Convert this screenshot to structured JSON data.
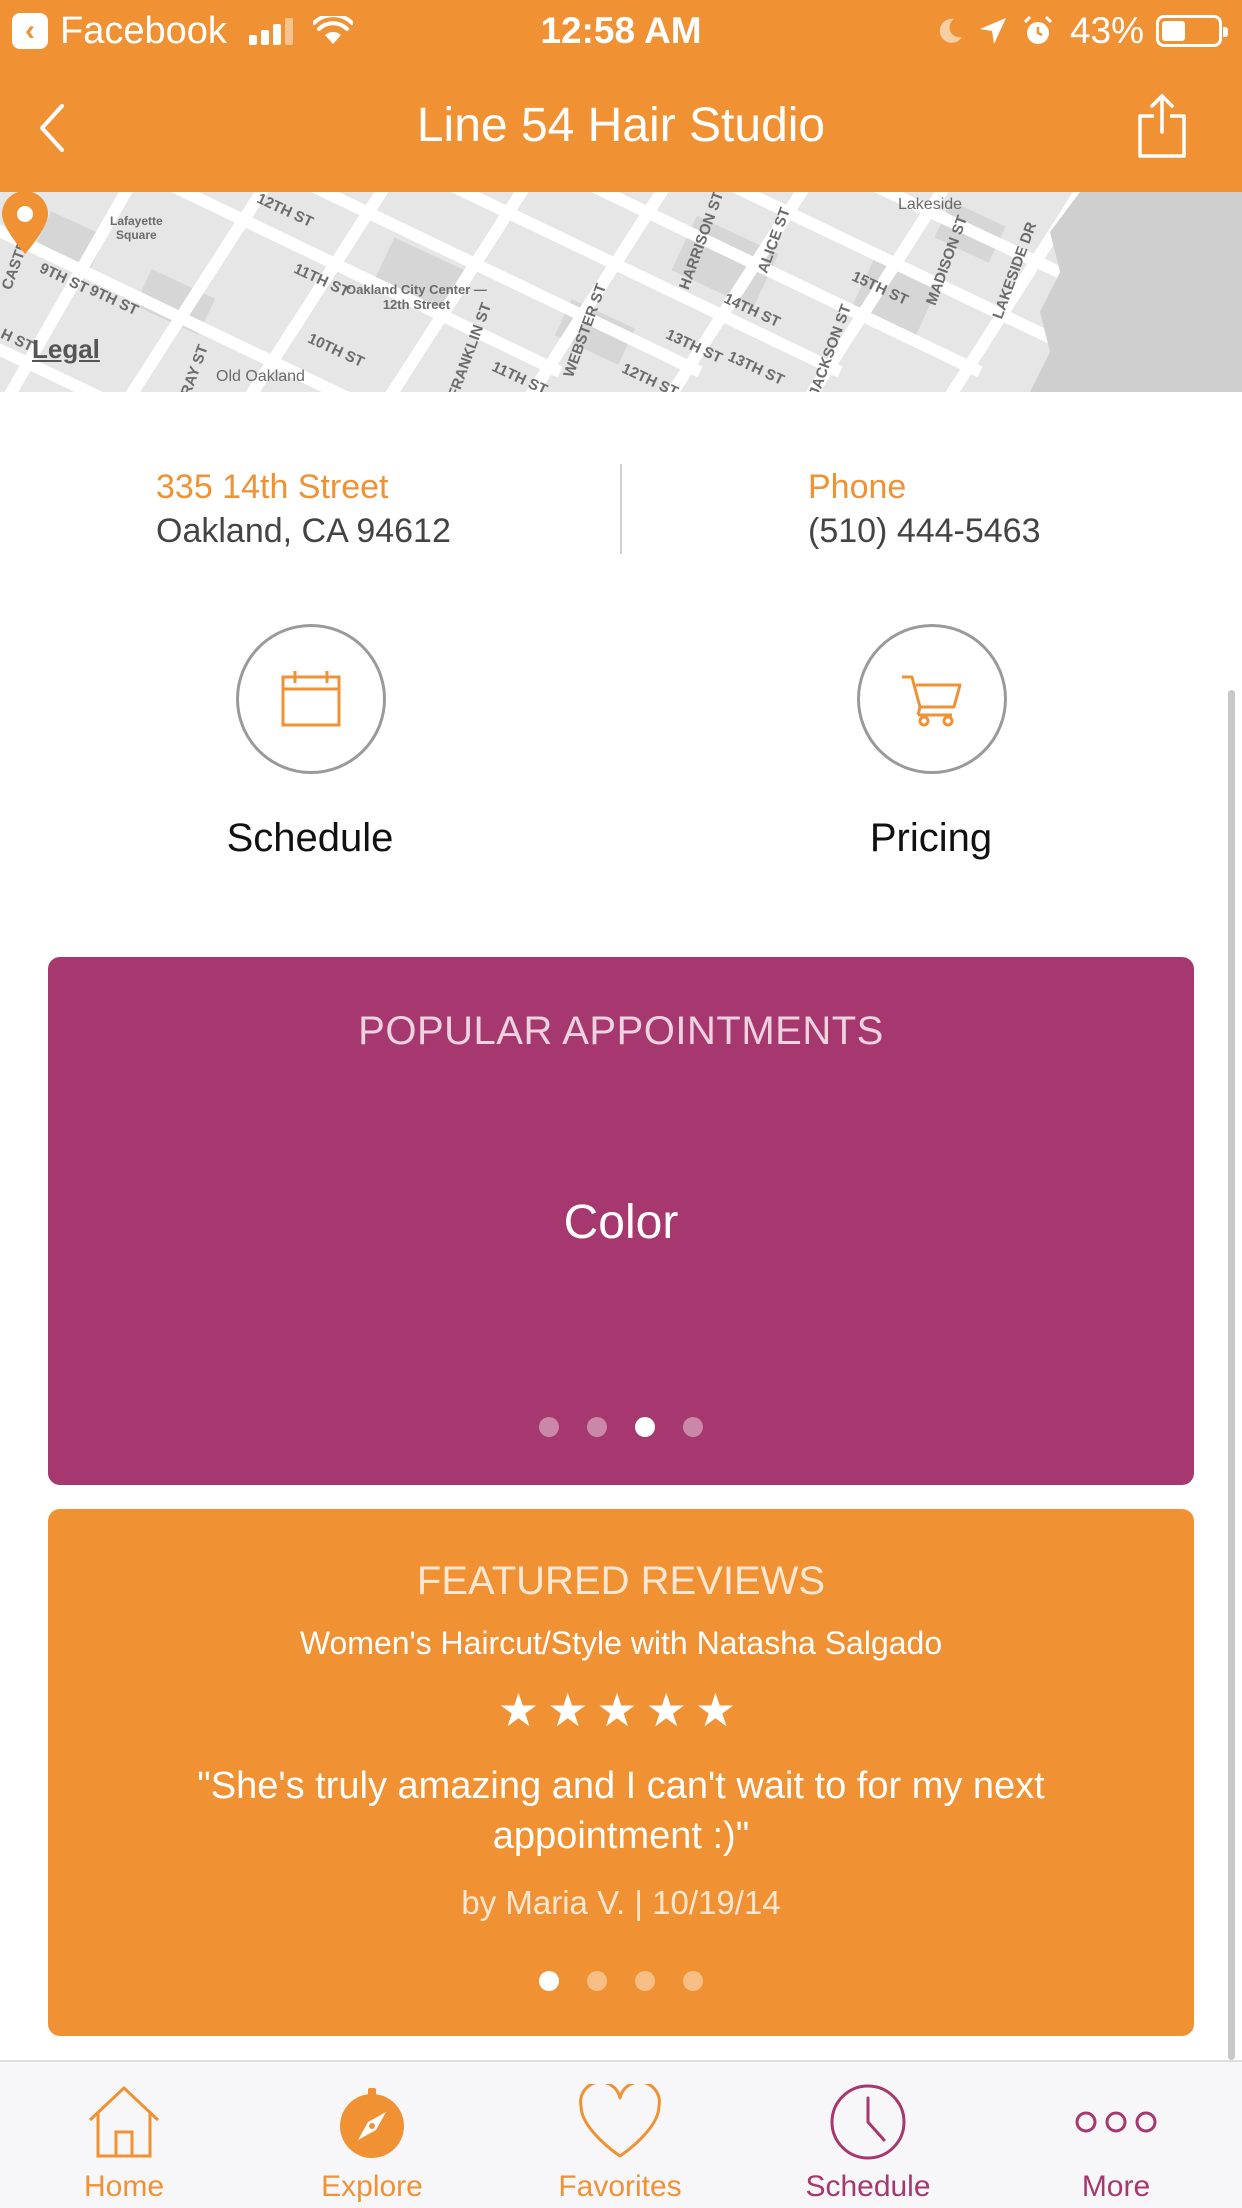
{
  "status_bar": {
    "back_app": "Facebook",
    "time": "12:58 AM",
    "battery": "43%",
    "battery_level": 0.43
  },
  "nav": {
    "title": "Line 54 Hair Studio"
  },
  "map": {
    "legal": "Legal",
    "labels": {
      "lafayette": "Lafayette\nSquare",
      "st_12th": "12TH ST",
      "castro": "CASTRO ST",
      "st_9th_a": "9TH ST",
      "st_9th_b": "9TH ST",
      "st_11th": "11TH ST",
      "city_center": "Oakland City Center —\n12th Street",
      "st_10th": "10TH ST",
      "old_oakland": "Old Oakland",
      "franklin": "FRANKLIN ST",
      "webster": "WEBSTER ST",
      "st_11th_b": "11TH ST",
      "harrison": "HARRISON ST",
      "alice": "ALICE ST",
      "st_14th": "14TH ST",
      "st_13th": "13TH ST",
      "st_13th_b": "13TH ST",
      "jackson": "JACKSON ST",
      "st_12th_b": "12TH ST",
      "lakeside": "Lakeside",
      "madison": "MADISON ST",
      "st_15th": "15TH ST",
      "lakeside_dr": "LAKESIDE DR",
      "ray": "RAY ST",
      "hst": "H ST"
    }
  },
  "contact": {
    "address_line1": "335 14th Street",
    "address_line2": "Oakland, CA 94612",
    "phone_label": "Phone",
    "phone_number": "(510) 444-5463"
  },
  "actions": {
    "schedule_label": "Schedule",
    "pricing_label": "Pricing"
  },
  "popular": {
    "title": "POPULAR APPOINTMENTS",
    "current_item": "Color",
    "page_count": 4,
    "active_page": 3
  },
  "reviews": {
    "title": "FEATURED REVIEWS",
    "service": "Women's Haircut/Style with Natasha Salgado",
    "stars": "★★★★★",
    "rating": 5,
    "quote": "\"She's truly amazing and I can't wait to for my next appointment :)\"",
    "byline": "by Maria  V.  |  10/19/14",
    "page_count": 4,
    "active_page": 1
  },
  "tabs": [
    {
      "label": "Home",
      "icon": "home-icon",
      "color": "#F09234"
    },
    {
      "label": "Explore",
      "icon": "compass-icon",
      "color": "#F09234"
    },
    {
      "label": "Favorites",
      "icon": "heart-icon",
      "color": "#F09234"
    },
    {
      "label": "Schedule",
      "icon": "clock-icon",
      "color": "#A7376F"
    },
    {
      "label": "More",
      "icon": "more-icon",
      "color": "#A7376F"
    }
  ],
  "colors": {
    "brand_orange": "#F09234",
    "brand_magenta": "#A7376F",
    "water": "#cfcfcf"
  }
}
